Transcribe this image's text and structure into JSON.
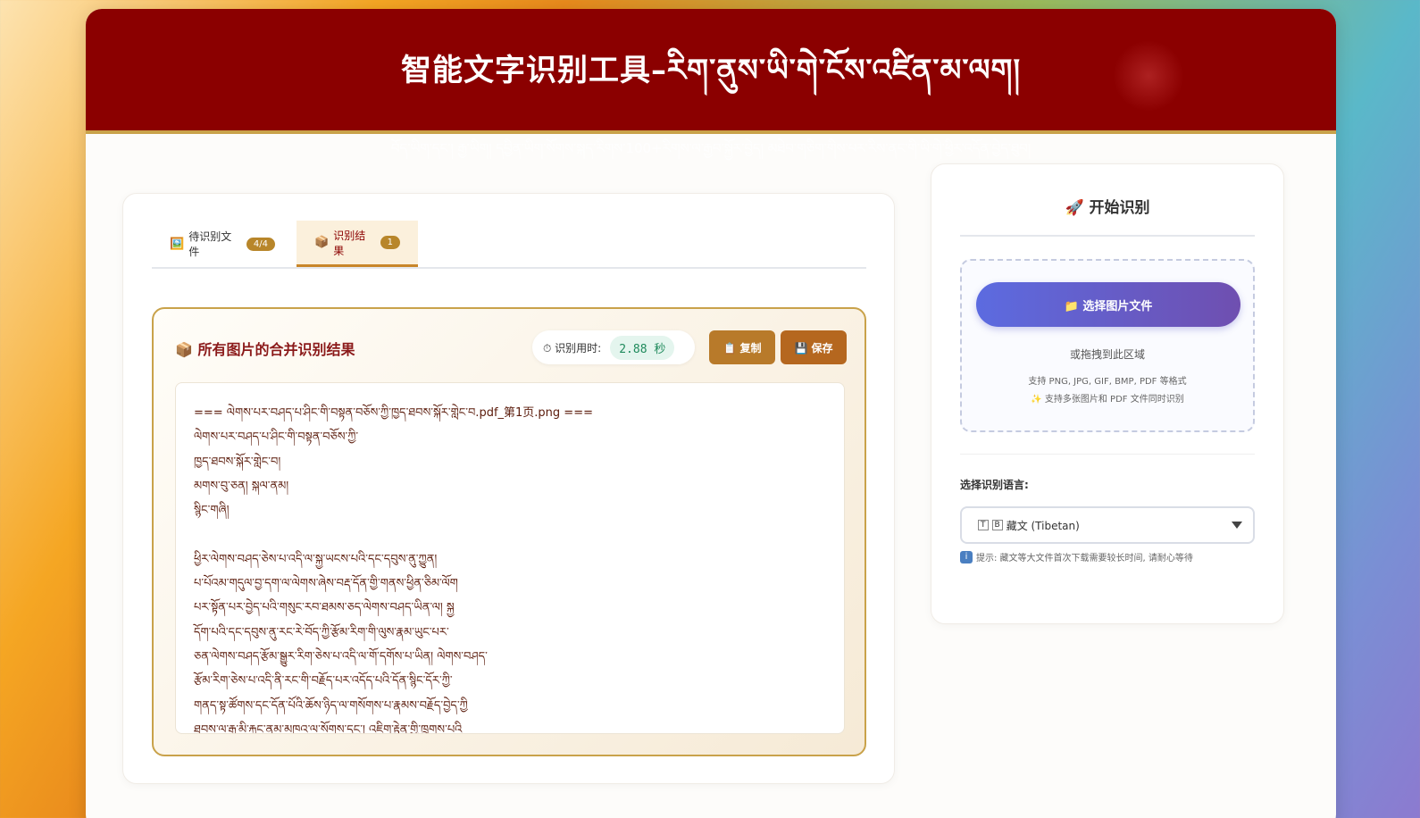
{
  "header": {
    "title": "智能文字识别工具–རིག་ནུས་ཡི་གེ་ངོས་འཛིན་མ་ལག།",
    "subtitle": "བོད་ཡིག་དང་། རྒྱ་ཡིག། དབྱིན་ཡིག་སོགས་སྐད་རིགས་100+རིགས་ལ་རྒྱབ་སྐྱོར་བྱེད། མཐེབ་གཅིག་གིས་པར་རིས་ནང་གི་ཡི་གེ་ཕྱིར་འདོན་བྱེད་ཐུབ།"
  },
  "tabs": [
    {
      "icon": "🖼️",
      "label": "待识别文件",
      "badge": "4/4"
    },
    {
      "icon": "📦",
      "label": "识别结果",
      "badge": "1"
    }
  ],
  "result": {
    "title": "📦 所有图片的合并识别结果",
    "timer_label": "⏱ 识别用时:",
    "timer_value": "2.88 秒",
    "copy_label": "📋 复制",
    "save_label": "💾 保存",
    "lines": [
      "=== ལེགས་པར་བཤད་པ་ཤིང་གི་བསྟན་བཅོས་ཀྱི་ཁྱད་ཐབས་སྐོར་གླེང་བ.pdf_第1页.png ===",
      "ལེགས་པར་བཤད་པ་ཤིང་གི་བསྟན་བཅོས་ཀྱི་",
      "ཁྱད་ཐབས་སྐོར་གླེང་བ།",
      "མགས་བུ་ཅན། སྐལ་ནམ།",
      "སྙིང་གཞི།",
      "",
      "ཕྱིར་ལེགས་བཤད་ཅེས་པ་འདི་ལ་སྐྱ་ཡངས་པའི་དང་དབུས་ནུ་ཀྱུན།",
      "པ་པོའམ་གདུལ་བྱ་དག་ལ་ལེགས་ཞེས་བརྡ་དོན་གྱི་གནས་ཕྱིན་ཅིམ་ལོག",
      "པར་སྟོན་པར་བྱེད་པའི་གསུང་རབ་ཐམས་ཅད་ལེགས་བཤད་ཡིན་ལ། སྐྱ",
      "དོག་པའི་དང་དབུས་ནུ་རང་རེ་བོད་ཀྱི་རྩོམ་རིག་གི་ལུས་རྣམ་ཡུང་པར་",
      "ཅན་ལེགས་བཤད་རྩོམ་སྒྱུར་རིག་ཅེས་པ་འདི་ལ་གོ་དགོས་པ་ཡིན། ལེགས་བཤད་",
      "རྩོམ་རིག་ཅེས་པ་འདི་ནི་རང་གི་བརྗོད་པར་འདོད་པའི་དོན་སྙིང་དོར་ཀྱི་",
      "གནད་སྟ་ཚོགས་དང་དོན་པོའི་ཆོས་ཉིད་ལ་གསོགས་པ་རྣམས་བརྗོད་བྱེད་ཀྱི",
      "ཐབས་ལ་རྒྱ་མི་རྐྱང་ནམ་མཁའ་ལ་སོགས་དང་། འཇིག་རྟེན་གྱི་ཁྲུགས་པའི"
    ]
  },
  "sidebar": {
    "title": "🚀 开始识别",
    "select_button": "📁 选择图片文件",
    "drop_hint": "或拖拽到此区域",
    "formats": "支持 PNG, JPG, GIF, BMP, PDF 等格式",
    "multi": "✨ 支持多张图片和 PDF 文件同时识别",
    "lang_label": "选择识别语言:",
    "lang_tb_t": "T",
    "lang_tb_b": "B",
    "lang_value": "藏文 (Tibetan)",
    "tip_icon": "i",
    "tip": "提示: 藏文等大文件首次下载需要较长时间, 请耐心等待"
  },
  "colors": {
    "header_bg": "#8b0000",
    "accent_gold": "#c9a24a",
    "button_gradient_start": "#5c6be0",
    "button_gradient_end": "#6f4fb0"
  }
}
